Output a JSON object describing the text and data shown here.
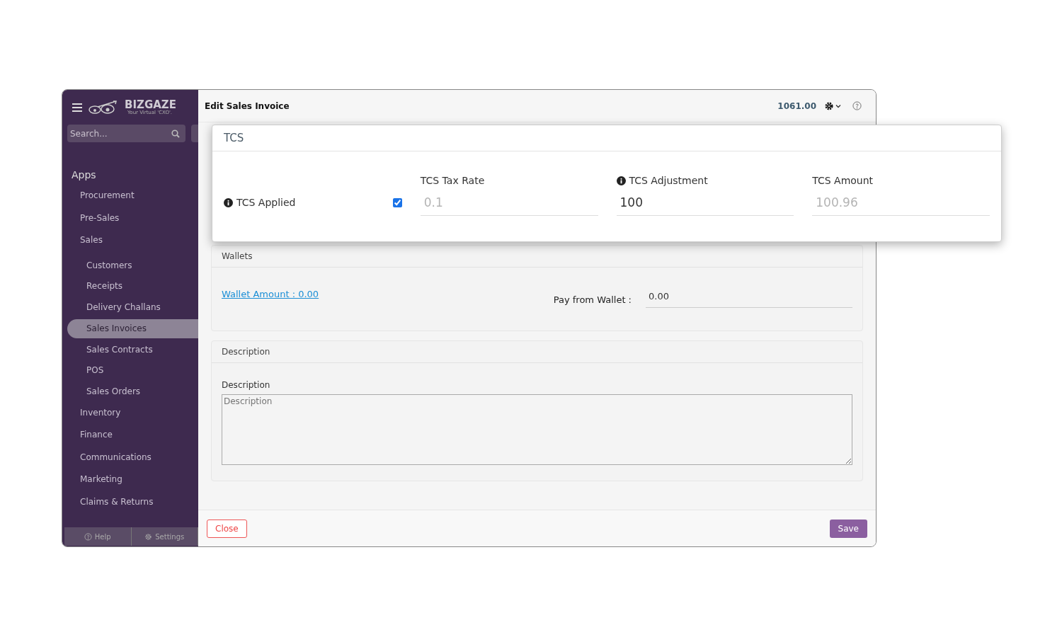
{
  "sidebar": {
    "brand": "BIZGAZE",
    "tagline": "Your Virtual 'CXO'.",
    "search": {
      "placeholder": "Search..."
    },
    "section": "Apps",
    "items": [
      {
        "label": "Procurement",
        "selected": false
      },
      {
        "label": "Pre-Sales",
        "selected": false
      },
      {
        "label": "Sales",
        "selected": false,
        "children": [
          {
            "label": "Customers",
            "selected": false
          },
          {
            "label": "Receipts",
            "selected": false
          },
          {
            "label": "Delivery Challans",
            "selected": false
          },
          {
            "label": "Sales Invoices",
            "selected": true
          },
          {
            "label": "Sales Contracts",
            "selected": false
          },
          {
            "label": "POS",
            "selected": false
          },
          {
            "label": "Sales Orders",
            "selected": false
          }
        ]
      },
      {
        "label": "Inventory",
        "selected": false
      },
      {
        "label": "Finance",
        "selected": false
      },
      {
        "label": "Communications",
        "selected": false
      },
      {
        "label": "Marketing",
        "selected": false
      },
      {
        "label": "Claims & Returns",
        "selected": false
      }
    ],
    "footer": [
      "Help",
      "Settings"
    ]
  },
  "header": {
    "title": "Edit Sales Invoice",
    "amount": "1061.00"
  },
  "tcs": {
    "title": "TCS",
    "applied_label": "TCS Applied",
    "applied": true,
    "fields": [
      {
        "label": "TCS Tax Rate",
        "value": "0.1",
        "disabled": true,
        "info": false
      },
      {
        "label": "TCS Adjustment",
        "value": "100",
        "disabled": false,
        "info": true
      },
      {
        "label": "TCS Amount",
        "value": "100.96",
        "disabled": true,
        "info": false
      }
    ]
  },
  "wallets": {
    "title": "Wallets",
    "link": "Wallet Amount : 0.00",
    "pay_label": "Pay from Wallet :",
    "pay_value": "0.00"
  },
  "description": {
    "title": "Description",
    "label": "Description",
    "placeholder": "Description"
  },
  "buttons": {
    "close": "Close",
    "save": "Save"
  }
}
